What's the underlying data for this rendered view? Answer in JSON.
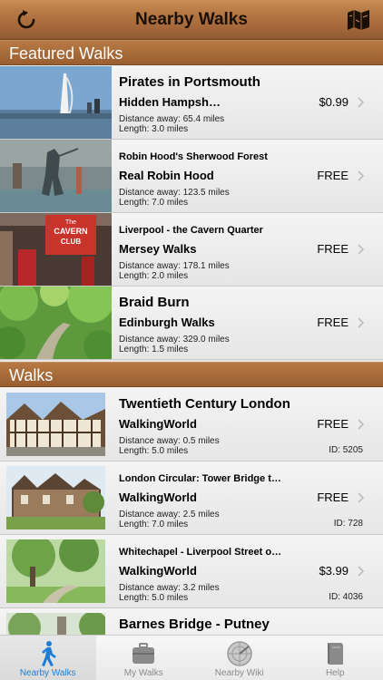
{
  "navbar": {
    "title": "Nearby Walks",
    "refresh_icon": "refresh-icon",
    "map_icon": "map-icon"
  },
  "sections": {
    "featured": "Featured Walks",
    "walks": "Walks"
  },
  "featured": [
    {
      "title": "Pirates in Portsmouth",
      "provider": "Hidden Hampsh…",
      "price": "$0.99",
      "distance": "Distance away: 65.4 miles",
      "length": "Length: 3.0 miles"
    },
    {
      "title": "Robin Hood's Sherwood Forest",
      "provider": "Real Robin Hood",
      "price": "FREE",
      "distance": "Distance away: 123.5 miles",
      "length": "Length: 7.0 miles"
    },
    {
      "title": "Liverpool - the Cavern Quarter",
      "provider": "Mersey Walks",
      "price": "FREE",
      "distance": "Distance away: 178.1 miles",
      "length": "Length: 2.0 miles",
      "sign1": "The",
      "sign2": "CAVERN",
      "sign3": "CLUB"
    },
    {
      "title": "Braid Burn",
      "provider": "Edinburgh Walks",
      "price": "FREE",
      "distance": "Distance away: 329.0 miles",
      "length": "Length: 1.5 miles"
    }
  ],
  "walks": [
    {
      "title": "Twentieth Century London",
      "provider": "WalkingWorld",
      "price": "FREE",
      "distance": "Distance away: 0.5 miles",
      "length": "Length: 5.0 miles",
      "id": "ID: 5205"
    },
    {
      "title": "London Circular: Tower Bridge t…",
      "provider": "WalkingWorld",
      "price": "FREE",
      "distance": "Distance away: 2.5 miles",
      "length": "Length: 7.0 miles",
      "id": "ID: 728"
    },
    {
      "title": "Whitechapel - Liverpool Street o…",
      "provider": "WalkingWorld",
      "price": "$3.99",
      "distance": "Distance away: 3.2 miles",
      "length": "Length: 5.0 miles",
      "id": "ID: 4036"
    },
    {
      "title": "Barnes Bridge - Putney"
    }
  ],
  "tabs": [
    {
      "label": "Nearby Walks",
      "icon": "walker-icon"
    },
    {
      "label": "My Walks",
      "icon": "suitcase-icon"
    },
    {
      "label": "Nearby Wiki",
      "icon": "radar-icon"
    },
    {
      "label": "Help",
      "icon": "book-icon"
    }
  ],
  "colors": {
    "nav_brown": "#b27441",
    "tab_active": "#1e7ed6",
    "row_bg": "#eeeeee"
  }
}
